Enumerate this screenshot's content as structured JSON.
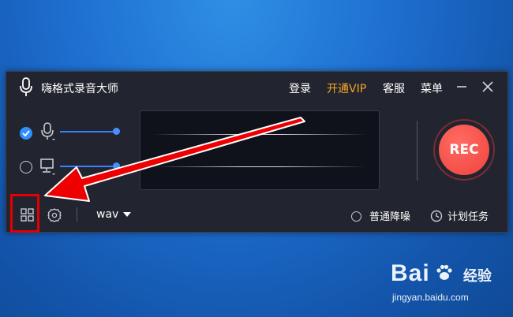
{
  "window": {
    "title": "嗨格式录音大师"
  },
  "menu": {
    "login": "登录",
    "vip": "开通VIP",
    "service": "客服",
    "menu": "菜单"
  },
  "sources": [
    {
      "icon": "microphone-icon",
      "checked": true
    },
    {
      "icon": "monitor-icon",
      "checked": false
    }
  ],
  "record": {
    "label": "REC"
  },
  "toolbar": {
    "format": "wav",
    "noise_reduction": "普通降噪",
    "schedule": "计划任务"
  },
  "watermark": {
    "brand": "Bai",
    "brand_cn": "经验",
    "url": "jingyan.baidu.com"
  },
  "colors": {
    "accent": "#2f8fff",
    "vip": "#f5a623",
    "rec": "#f0433c",
    "annotation": "#e40000"
  }
}
